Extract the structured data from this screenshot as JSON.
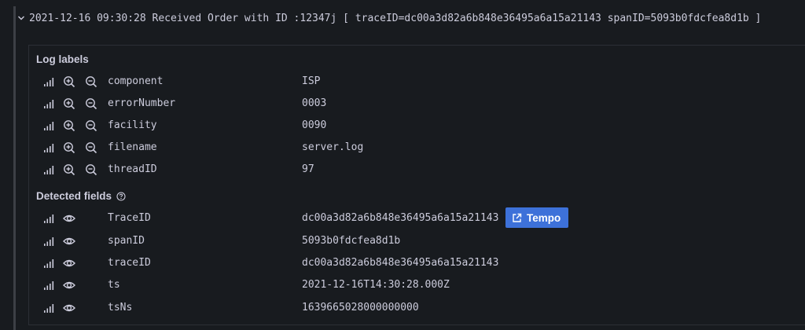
{
  "log_line": {
    "text": "2021-12-16 09:30:28 Received Order with ID :12347j [ traceID=dc00a3d82a6b848e36495a6a15a21143 spanID=5093b0fdcfea8d1b ]"
  },
  "log_labels": {
    "title": "Log labels",
    "rows": [
      {
        "key": "component",
        "value": "ISP"
      },
      {
        "key": "errorNumber",
        "value": "0003"
      },
      {
        "key": "facility",
        "value": "0090"
      },
      {
        "key": "filename",
        "value": "server.log"
      },
      {
        "key": "threadID",
        "value": "97"
      }
    ]
  },
  "detected_fields": {
    "title": "Detected fields",
    "rows": [
      {
        "key": "TraceID",
        "value": "dc00a3d82a6b848e36495a6a15a21143",
        "link_label": "Tempo"
      },
      {
        "key": "spanID",
        "value": "5093b0fdcfea8d1b"
      },
      {
        "key": "traceID",
        "value": "dc00a3d82a6b848e36495a6a15a21143"
      },
      {
        "key": "ts",
        "value": "2021-12-16T14:30:28.000Z"
      },
      {
        "key": "tsNs",
        "value": "1639665028000000000"
      }
    ]
  },
  "colors": {
    "background": "#181b1f",
    "text": "#ccccdc",
    "accent": "#3d71d9",
    "border": "#2c2f35"
  }
}
